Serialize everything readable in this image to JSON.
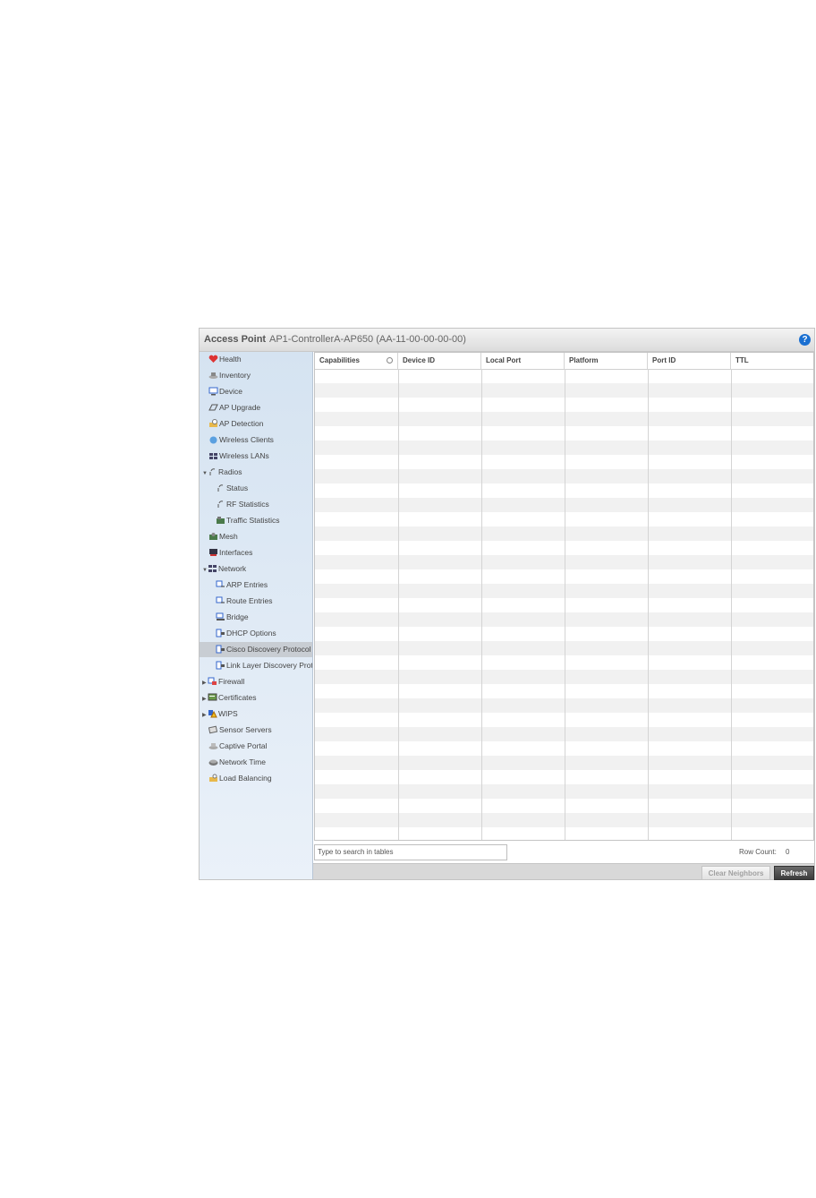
{
  "header": {
    "title": "Access Point",
    "subtitle": "AP1-ControllerA-AP650 (AA-11-00-00-00-00)",
    "help": "?"
  },
  "sidebar": {
    "items": [
      {
        "label": "Health",
        "icon": "health-icon"
      },
      {
        "label": "Inventory",
        "icon": "inventory-icon"
      },
      {
        "label": "Device",
        "icon": "device-icon"
      },
      {
        "label": "AP Upgrade",
        "icon": "ap-upgrade-icon"
      },
      {
        "label": "AP Detection",
        "icon": "ap-detection-icon"
      },
      {
        "label": "Wireless Clients",
        "icon": "wireless-clients-icon"
      },
      {
        "label": "Wireless LANs",
        "icon": "wireless-lans-icon"
      },
      {
        "label": "Radios",
        "icon": "radio-icon"
      },
      {
        "label": "Status",
        "icon": "radio-icon"
      },
      {
        "label": "RF Statistics",
        "icon": "radio-icon"
      },
      {
        "label": "Traffic Statistics",
        "icon": "traffic-icon"
      },
      {
        "label": "Mesh",
        "icon": "mesh-icon"
      },
      {
        "label": "Interfaces",
        "icon": "interfaces-icon"
      },
      {
        "label": "Network",
        "icon": "network-icon"
      },
      {
        "label": "ARP Entries",
        "icon": "arp-icon"
      },
      {
        "label": "Route Entries",
        "icon": "route-icon"
      },
      {
        "label": "Bridge",
        "icon": "bridge-icon"
      },
      {
        "label": "DHCP Options",
        "icon": "dhcp-icon"
      },
      {
        "label": "Cisco Discovery Protocol",
        "icon": "cdp-icon"
      },
      {
        "label": "Link Layer Discovery Protocol",
        "icon": "lldp-icon"
      },
      {
        "label": "Firewall",
        "icon": "firewall-icon"
      },
      {
        "label": "Certificates",
        "icon": "certificate-icon"
      },
      {
        "label": "WIPS",
        "icon": "wips-icon"
      },
      {
        "label": "Sensor Servers",
        "icon": "sensor-icon"
      },
      {
        "label": "Captive Portal",
        "icon": "captive-portal-icon"
      },
      {
        "label": "Network Time",
        "icon": "network-time-icon"
      },
      {
        "label": "Load Balancing",
        "icon": "load-balancing-icon"
      }
    ]
  },
  "table": {
    "columns": [
      "Capabilities",
      "Device ID",
      "Local Port",
      "Platform",
      "Port ID",
      "TTL"
    ],
    "rows": []
  },
  "search": {
    "placeholder": "Type to search in tables"
  },
  "row_count": {
    "label": "Row Count:",
    "value": "0"
  },
  "buttons": {
    "clear": "Clear Neighbors",
    "refresh": "Refresh"
  },
  "colors": {
    "sidebar": "#dfe9f5",
    "selected": "#c8cdd3",
    "refresh": "#444444"
  }
}
